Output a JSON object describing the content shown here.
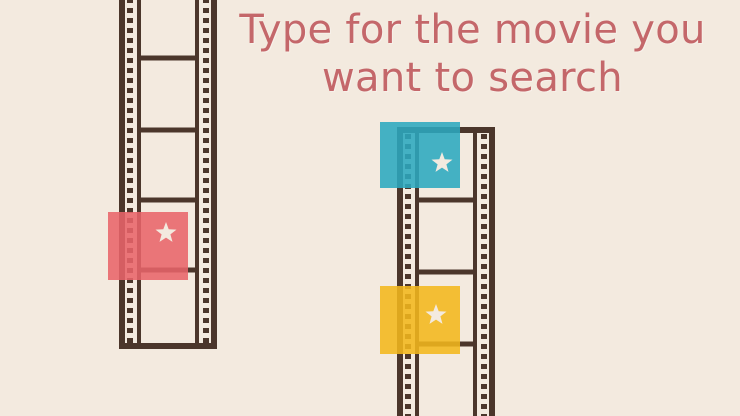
{
  "prompt": {
    "line1": "Type for the movie you",
    "line2": "want to search"
  },
  "colors": {
    "background": "#f3eadf",
    "film": "#4b362b",
    "text": "#c4676a",
    "red_tile": "#e8646a",
    "blue_tile": "#2ba8bf",
    "yellow_tile": "#f2b71c",
    "star": "#f3eadf"
  },
  "icons": [
    "star-icon",
    "star-icon",
    "star-icon"
  ]
}
